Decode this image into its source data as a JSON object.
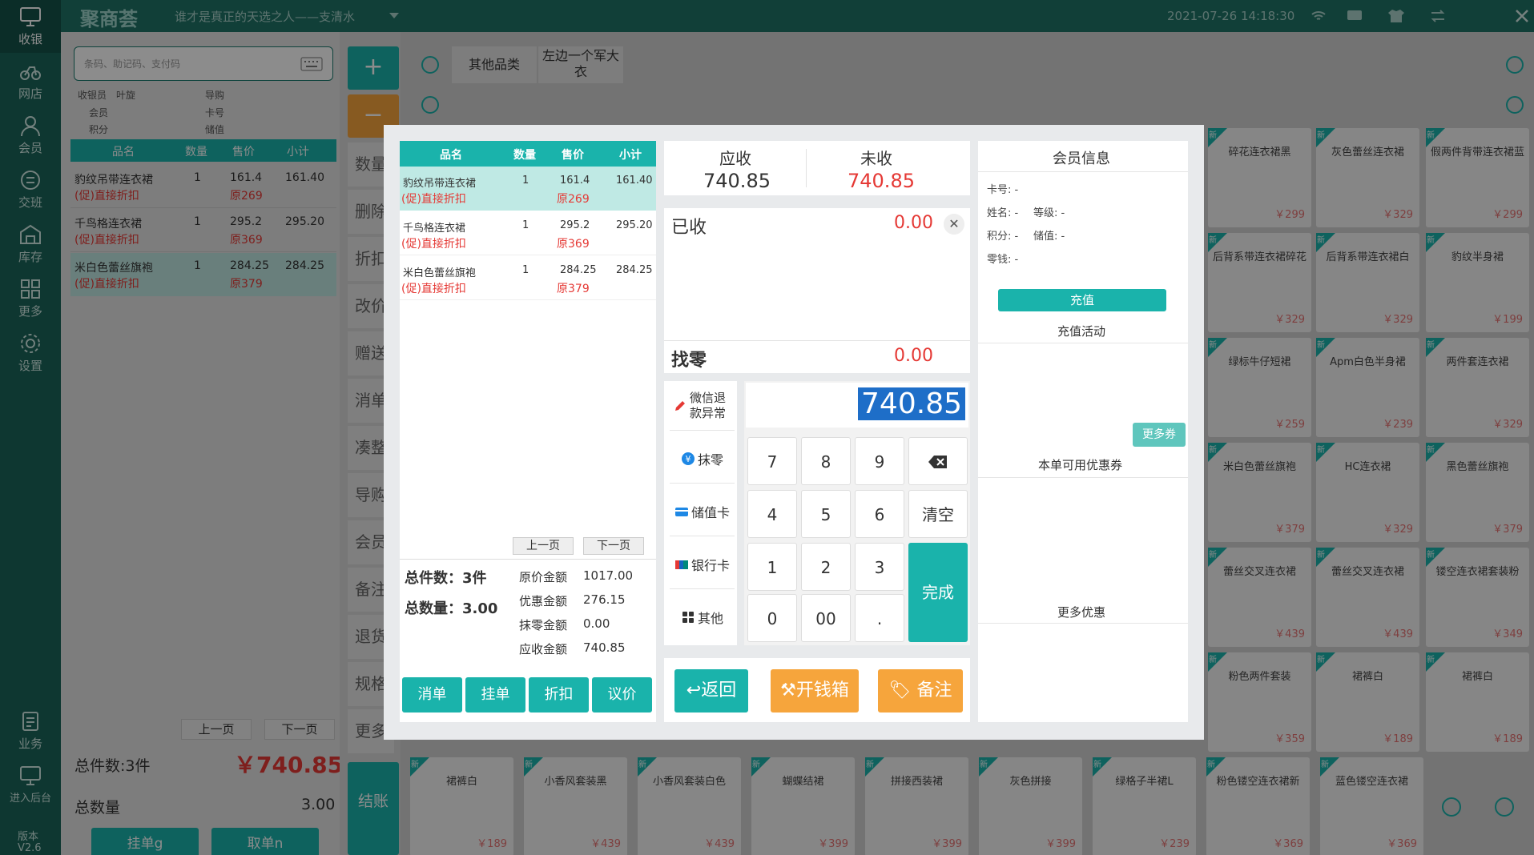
{
  "app": {
    "logo": "聚商荟",
    "slogan": "谁才是真正的天选之人——支清水",
    "datetime": "2021-07-26 14:18:30",
    "version_label": "版本",
    "version": "V2.6"
  },
  "sidebar": {
    "items": [
      {
        "label": "收银",
        "icon": "monitor-icon"
      },
      {
        "label": "网店",
        "icon": "bike-icon"
      },
      {
        "label": "会员",
        "icon": "user-icon"
      },
      {
        "label": "交班",
        "icon": "exchange-icon"
      },
      {
        "label": "库存",
        "icon": "warehouse-icon"
      },
      {
        "label": "更多",
        "icon": "grid-icon"
      },
      {
        "label": "设置",
        "icon": "gear-icon"
      }
    ],
    "bottom": [
      {
        "label": "业务",
        "icon": "clipboard-icon"
      },
      {
        "label": "进入后台",
        "icon": "desktop-icon"
      }
    ]
  },
  "cart": {
    "search_placeholder": "条码、助记码、支付码",
    "cashier_label": "收银员",
    "cashier": "叶旋",
    "guide_label": "导购",
    "member_label": "会员",
    "card_label": "卡号",
    "points_label": "积分",
    "balance_label": "储值",
    "headers": [
      "品名",
      "数量",
      "售价",
      "小计"
    ],
    "rows": [
      {
        "name": "豹纹吊带连衣裙",
        "qty": "1",
        "price": "161.4",
        "subtotal": "161.40",
        "promo": "(促)直接折扣",
        "orig": "原269"
      },
      {
        "name": "千鸟格连衣裙",
        "qty": "1",
        "price": "295.2",
        "subtotal": "295.20",
        "promo": "(促)直接折扣",
        "orig": "原369"
      },
      {
        "name": "米白色蕾丝旗袍",
        "qty": "1",
        "price": "284.25",
        "subtotal": "284.25",
        "promo": "(促)直接折扣",
        "orig": "原379"
      }
    ],
    "prev": "上一页",
    "next": "下一页",
    "total_items": "总件数:3件",
    "total_amount": "￥740.85",
    "total_qty_label": "总数量",
    "total_qty": "3.00",
    "hold_btn": "挂单g",
    "take_btn": "取单n"
  },
  "actions": [
    "数量",
    "删除",
    "折扣",
    "改价",
    "赠送",
    "消单",
    "凑整",
    "导购",
    "会员",
    "备注",
    "退货",
    "规格",
    "更多"
  ],
  "checkout_btn": "结账",
  "categories": [
    "其他品类",
    "左边一个军大衣"
  ],
  "products": [
    {
      "name": "碎花连衣裙黑",
      "price": "￥299"
    },
    {
      "name": "灰色蕾丝连衣裙",
      "price": "￥329"
    },
    {
      "name": "假两件背带连衣裙蓝",
      "price": "￥299"
    },
    {
      "name": "后背系带连衣裙碎花",
      "price": "￥329"
    },
    {
      "name": "后背系带连衣裙白",
      "price": "￥329"
    },
    {
      "name": "豹纹半身裙",
      "price": "￥199"
    },
    {
      "name": "绿标牛仔短裙",
      "price": "￥259"
    },
    {
      "name": "Apm白色半身裙",
      "price": "￥239"
    },
    {
      "name": "两件套连衣裙",
      "price": "￥329"
    },
    {
      "name": "米白色蕾丝旗袍",
      "price": "￥379"
    },
    {
      "name": "HC连衣裙",
      "price": "￥329"
    },
    {
      "name": "黑色蕾丝旗袍",
      "price": "￥379"
    },
    {
      "name": "蕾丝交叉连衣裙",
      "price": "￥439"
    },
    {
      "name": "蕾丝交叉连衣裙",
      "price": "￥439"
    },
    {
      "name": "镂空连衣裙套装粉",
      "price": "￥349"
    },
    {
      "name": "粉色两件套装",
      "price": "￥359"
    },
    {
      "name": "裙裤白",
      "price": "￥189"
    },
    {
      "name": "裙裤白",
      "price": "￥189"
    }
  ],
  "bottom_products": [
    {
      "name": "裙裤白",
      "price": "￥189"
    },
    {
      "name": "小香风套装黑",
      "price": "￥439"
    },
    {
      "name": "小香风套装白色",
      "price": "￥439"
    },
    {
      "name": "蝴蝶结裙",
      "price": "￥399"
    },
    {
      "name": "拼接西装裙",
      "price": "￥399"
    },
    {
      "name": "灰色拼接",
      "price": "￥399"
    },
    {
      "name": "绿格子半裙L",
      "price": "￥239"
    },
    {
      "name": "粉色镂空连衣裙新",
      "price": "￥369"
    },
    {
      "name": "蓝色镂空连衣裙",
      "price": "￥369"
    }
  ],
  "new_tag": "新",
  "modal": {
    "headers": [
      "品名",
      "数量",
      "售价",
      "小计"
    ],
    "rows": [
      {
        "name": "豹纹吊带连衣裙",
        "qty": "1",
        "price": "161.4",
        "subtotal": "161.40",
        "promo": "(促)直接折扣",
        "orig": "原269"
      },
      {
        "name": "千鸟格连衣裙",
        "qty": "1",
        "price": "295.2",
        "subtotal": "295.20",
        "promo": "(促)直接折扣",
        "orig": "原369"
      },
      {
        "name": "米白色蕾丝旗袍",
        "qty": "1",
        "price": "284.25",
        "subtotal": "284.25",
        "promo": "(促)直接折扣",
        "orig": "原379"
      }
    ],
    "prev": "上一页",
    "next": "下一页",
    "total_items": "总件数：3件",
    "total_qty": "总数量：3.00",
    "summary": [
      {
        "label": "原价金额",
        "value": "1017.00"
      },
      {
        "label": "优惠金额",
        "value": "276.15"
      },
      {
        "label": "抹零金额",
        "value": "0.00"
      },
      {
        "label": "应收金额",
        "value": "740.85"
      }
    ],
    "btns": [
      "消单",
      "挂单",
      "折扣",
      "议价"
    ],
    "receivable_label": "应收",
    "receivable": "740.85",
    "unpaid_label": "未收",
    "unpaid": "740.85",
    "received_label": "已收",
    "received": "0.00",
    "change_label": "找零",
    "change": "0.00",
    "input_value": "740.85",
    "pay_methods": [
      {
        "label": "微信退款异常",
        "icon": "pencil-icon",
        "color": "#e53935"
      },
      {
        "label": "抹零",
        "icon": "yen-icon",
        "color": "#1e88e5"
      },
      {
        "label": "储值卡",
        "icon": "card-icon",
        "color": "#1e88e5"
      },
      {
        "label": "银行卡",
        "icon": "unionpay-icon",
        "color": "#e53935"
      },
      {
        "label": "其他",
        "icon": "apps-icon",
        "color": "#333333"
      }
    ],
    "keys": [
      "7",
      "8",
      "9",
      "4",
      "5",
      "6",
      "1",
      "2",
      "3",
      "0",
      "00",
      "."
    ],
    "clear": "清空",
    "done": "完成",
    "back": "返回",
    "drawer": "开钱箱",
    "note": "备注",
    "member_title": "会员信息",
    "member_card": "卡号: -",
    "member_name": "姓名: -",
    "member_level": "等级: -",
    "member_points": "积分: -",
    "member_balance": "储值: -",
    "member_change": "零钱: -",
    "recharge": "充值",
    "recharge_activity": "充值活动",
    "more_coupons": "更多券",
    "coupons_title": "本单可用优惠券",
    "more_discounts": "更多优惠"
  },
  "colors": {
    "teal": "#1ab3ab",
    "dark_green": "#1a6459",
    "orange": "#f6a53c",
    "red": "#e53935"
  }
}
